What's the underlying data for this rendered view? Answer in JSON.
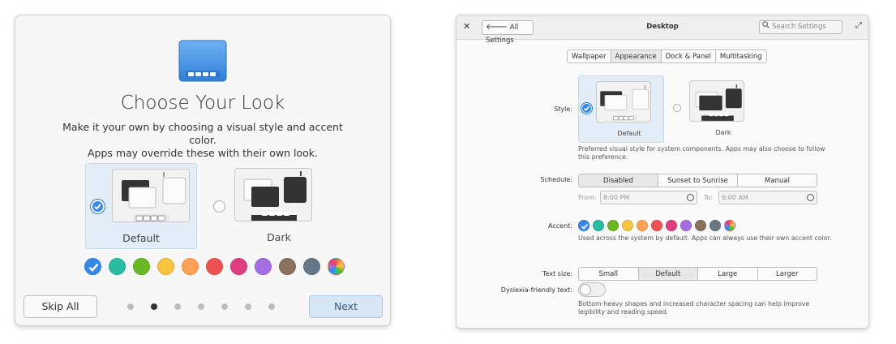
{
  "onboarding": {
    "title": "Choose Your Look",
    "description_line1": "Make it your own by choosing a visual style and accent color.",
    "description_line2": "Apps may override these with their own look.",
    "styles": [
      {
        "label": "Default",
        "selected": true
      },
      {
        "label": "Dark",
        "selected": false
      }
    ],
    "accents": [
      {
        "name": "blue",
        "color": "#3689e6",
        "selected": true
      },
      {
        "name": "mint",
        "color": "#28bca3"
      },
      {
        "name": "green",
        "color": "#68b723"
      },
      {
        "name": "yellow",
        "color": "#f9c440"
      },
      {
        "name": "orange",
        "color": "#ffa154"
      },
      {
        "name": "red",
        "color": "#ed5353"
      },
      {
        "name": "pink",
        "color": "#de3e80"
      },
      {
        "name": "purple",
        "color": "#a56de2"
      },
      {
        "name": "brown",
        "color": "#8a715e"
      },
      {
        "name": "slate",
        "color": "#667885"
      },
      {
        "name": "auto",
        "color": "multicolor"
      }
    ],
    "skip_label": "Skip All",
    "next_label": "Next",
    "page_count": 7,
    "current_page": 2
  },
  "settings": {
    "window": {
      "back_label": "All Settings",
      "title": "Desktop",
      "search_placeholder": "Search Settings"
    },
    "tabs": [
      {
        "label": "Wallpaper",
        "active": false
      },
      {
        "label": "Appearance",
        "active": true
      },
      {
        "label": "Dock & Panel",
        "active": false
      },
      {
        "label": "Multitasking",
        "active": false
      }
    ],
    "style": {
      "label": "Style:",
      "options": [
        {
          "label": "Default",
          "selected": true
        },
        {
          "label": "Dark",
          "selected": false
        }
      ],
      "hint_line1": "Preferred visual style for system components. Apps may also choose to follow",
      "hint_line2": "this preference."
    },
    "schedule": {
      "label": "Schedule:",
      "options": [
        {
          "label": "Disabled",
          "active": true
        },
        {
          "label": "Sunset to Sunrise",
          "active": false
        },
        {
          "label": "Manual",
          "active": false
        }
      ],
      "from_label": "From:",
      "from_value": "8:00 PM",
      "to_label": "To:",
      "to_value": "6:00 AM"
    },
    "accent": {
      "label": "Accent:",
      "hint": "Used across the system by default. Apps can always use their own accent color."
    },
    "text_size": {
      "label": "Text size:",
      "options": [
        {
          "label": "Small",
          "active": false
        },
        {
          "label": "Default",
          "active": true
        },
        {
          "label": "Large",
          "active": false
        },
        {
          "label": "Larger",
          "active": false
        }
      ]
    },
    "dyslexia": {
      "label": "Dyslexia-friendly text:",
      "enabled": false,
      "hint_line1": "Bottom-heavy shapes and increased character spacing can help improve",
      "hint_line2": "legibility and reading speed."
    }
  }
}
